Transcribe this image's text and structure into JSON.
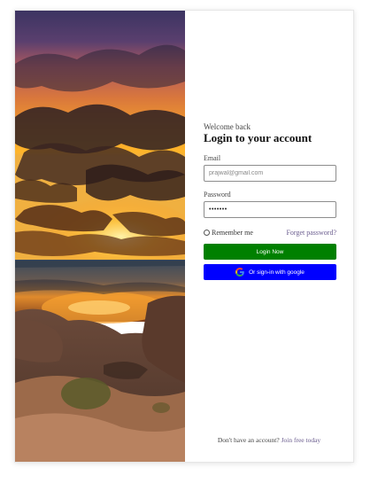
{
  "colors": {
    "login_button": "#008000",
    "google_button": "#0000ff",
    "link": "#6a5c8e"
  },
  "hero": {
    "image": "sunset-beach-photo"
  },
  "form": {
    "welcome": "Welcome back",
    "title": "Login to your account",
    "email_label": "Email",
    "email_placeholder": "prajwal@gmail.com",
    "password_label": "Password",
    "password_value": "•••••••",
    "remember_label": "Remember me",
    "forgot_link": "Forget password?",
    "login_button": "Login Now",
    "google_button": "Or sign-in with google",
    "google_icon": "google-icon"
  },
  "footer": {
    "prompt": "Don't have an account?",
    "signup_link": "Join free today"
  }
}
